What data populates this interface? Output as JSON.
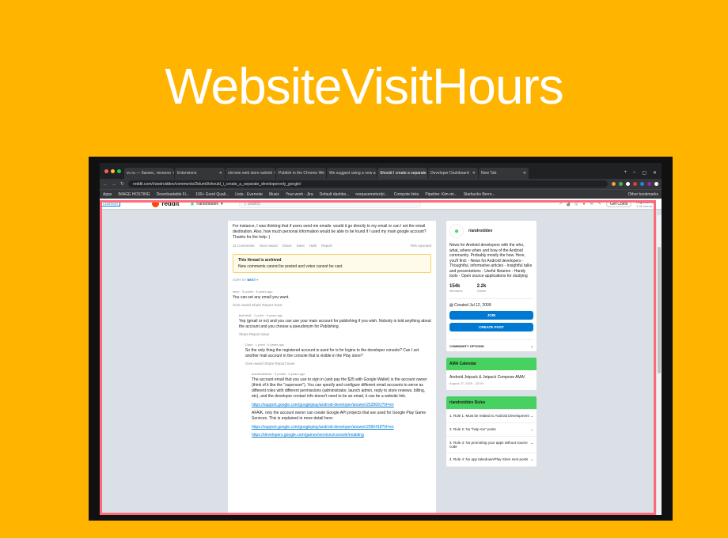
{
  "headline": "WebsiteVisitHours",
  "browser": {
    "tabs": [
      {
        "label": "vc.ru — бизнес, техноло"
      },
      {
        "label": "Extensions"
      },
      {
        "label": "chrome web store submit"
      },
      {
        "label": "Publish in the Chrome We"
      },
      {
        "label": "We suggest using a new a"
      },
      {
        "label": "Should I create a separate",
        "active": true
      },
      {
        "label": "Developer Dashboard"
      },
      {
        "label": "New Tab"
      }
    ],
    "url": "reddit.com/r/androiddev/comments/2idum9/should_i_create_a_separate_developeronly_google/",
    "bookmarks": [
      "Apps",
      "IMAGE HOSTING",
      "Downloadable Fi...",
      "100+ Good Quali...",
      "Lists - Evernote",
      "Music",
      "Your work - Jira",
      "Default dashbo...",
      "norpasemeter/pl...",
      "Compote links",
      "Pipeline: Kim-mi...",
      "Starbucks Berro...",
      "Other bookmarks"
    ]
  },
  "reddit": {
    "logo": "reddit",
    "subreddit": "r/androiddev",
    "search_placeholder": "Search",
    "coins": "Get Coins",
    "username": "forgoodwind",
    "karma": "1.3k karma",
    "left_edge_label": "CONTENT",
    "post_text": "For instance, I was thinking that if users send me emails- would it go directly to my email or can I set the email destination. Also, how much personal information would be able to be found if I used my main google account? Thanks for the help :)",
    "post_actions": [
      "11 Comments",
      "Give Award",
      "Share",
      "Save",
      "Hide",
      "Report"
    ],
    "upvoted": "76% Upvoted",
    "archived_title": "This thread is archived",
    "archived_text": "New comments cannot be posted and votes cannot be cast",
    "sort_label": "SORT BY",
    "sort_value": "BEST",
    "comments": [
      {
        "meta": "sesrl · 5 points · 6 years ago",
        "body": "You can set any email you want.",
        "actions": "Give Award   Share   Report   Save"
      },
      {
        "meta": "[deleted] · 1 point · 6 years ago",
        "body": "Yep (gmail or no) and you can use your main account for publishing if you wish. Nobody is told anything about the account and you choose a pseudonym for Publishing.",
        "actions": "Share   Report   Save"
      },
      {
        "meta": "Dask · 1 point · 6 years ago",
        "body": "So the only thing the registered account is used for is for logins to the developer console? Can I set another mail account in the console that is visible in the Play store?",
        "actions": "Give Award   Share   Report   Save"
      },
      {
        "meta": "autotradetests · 3 points · 6 years ago",
        "body": "The account email that you use to sign in (and pay the $25 with Google Wallet) is the account owner (think of it like the \"superuser\"). You can specify and configure different email accounts to serve as different roles with different permissions (administrator, launch admin, reply to store reviews, billing, etc), and the developer contact info doesn't need to be an email, it can be a website link.",
        "link1": "https://support.google.com/googleplay/android-developer/answer/2528691?hl=en",
        "body2": "AFAIK, only the account owner can create Google API projects that are used for Google Play Game Services. This is explained in more detail here:",
        "link2": "https://support.google.com/googleplay/android-developer/answer/2990418?hl=en",
        "link3": "https://developers.google.com/games/services/console/enabling"
      }
    ],
    "sidebar": {
      "name": "r/androiddev",
      "description": "News for Android developers with the who, what, where when and how of the Android community. Probably mostly the how. Here, you'll find: - News for Android developers - Thoughtful, informative articles - Insightful talks and presentations - Useful libraries - Handy tools - Open source applications for studying",
      "members": "154k",
      "members_label": "Members",
      "online": "2.2k",
      "online_label": "Online",
      "created": "Created Jul 12, 2009",
      "join": "JOIN",
      "create_post": "CREATE POST",
      "community_options": "COMMUNITY OPTIONS",
      "calendar_header": "AMA Calendar",
      "calendar_event": "Android Jetpack & Jetpack Compose AMA!",
      "calendar_date": "August 27, 2020 - 22:00",
      "rules_header": "r/androiddev Rules",
      "rules": [
        "1. Rule 1: Must be related to Android Development",
        "2. Rule 2: No \"help me\" posts",
        "3. Rule 3: No promoting your apps without source code",
        "4. Rule 4: No app takedown/Play Store sent posts"
      ]
    }
  },
  "colors": {
    "background": "#FFB400",
    "overlay": "#ff6a7a",
    "accent": "#0079d3",
    "sidebar_header": "#46d160"
  }
}
